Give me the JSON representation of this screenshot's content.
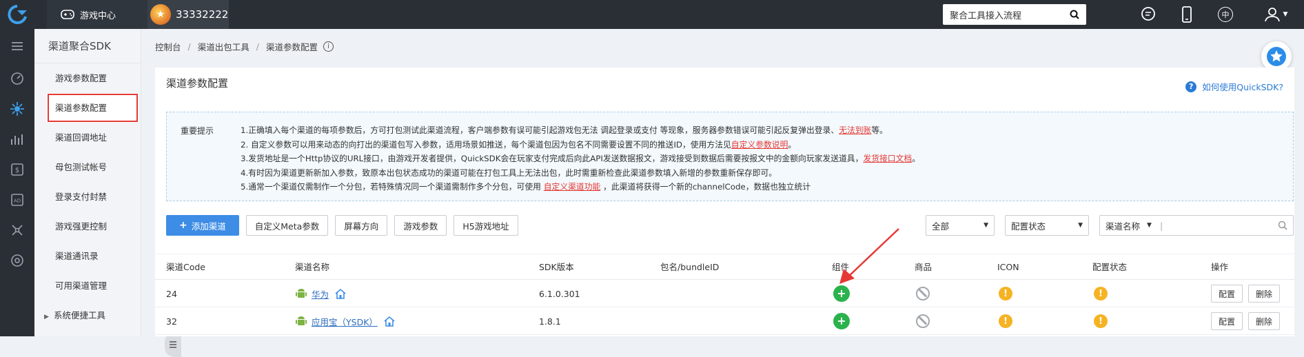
{
  "topbar": {
    "game_center_label": "游戏中心",
    "account_number": "33332222",
    "search_value": "聚合工具接入流程",
    "lang_label": "中"
  },
  "sidebar": {
    "title": "渠道聚合SDK",
    "items": [
      {
        "label": "游戏参数配置"
      },
      {
        "label": "渠道参数配置"
      },
      {
        "label": "渠道回调地址"
      },
      {
        "label": "母包测试帐号"
      },
      {
        "label": "登录支付封禁"
      },
      {
        "label": "游戏强更控制"
      },
      {
        "label": "渠道通讯录"
      },
      {
        "label": "可用渠道管理"
      },
      {
        "label": "系统便捷工具"
      }
    ]
  },
  "breadcrumb": [
    "控制台",
    "渠道出包工具",
    "渠道参数配置"
  ],
  "panel": {
    "title": "渠道参数配置",
    "help_link": "如何使用QuickSDK?"
  },
  "notice": {
    "label": "重要提示",
    "line1_pre": "1.正确填入每个渠道的每项参数后，方可打包测试此渠道流程，客户端参数有误可能引起游戏包无法 调起登录或支付 等现象，服务器参数错误可能引起反复弹出登录、",
    "line1_link": "无法到账",
    "line1_post": "等。",
    "line2_pre": "2. 自定义参数可以用来动态的向打出的渠道包写入参数，适用场景如推送，每个渠道包因为包名不同需要设置不同的推送ID，使用方法见",
    "line2_link": "自定义参数说明",
    "line2_post": "。",
    "line3_pre": "3.发货地址是一个Http协议的URL接口，由游戏开发者提供，QuickSDK会在玩家支付完成后向此API发送数据报文，游戏接受到数据后需要按报文中的金额向玩家发送道具，",
    "line3_link": "发货接口文档",
    "line3_post": "。",
    "line4": "4.有时因为渠道更新新加入参数，致原本出包状态成功的渠道可能在打包工具上无法出包，此时需重新检查此渠道参数填入新增的参数重新保存即可。",
    "line5_pre": "5.通常一个渠道仅需制作一个分包，若特殊情况同一个渠道需制作多个分包，可使用 ",
    "line5_link": "自定义渠道功能",
    "line5_post": " ，此渠道将获得一个新的channelCode，数据也独立统计"
  },
  "toolbar": {
    "add_label": "添加渠道",
    "meta_label": "自定义Meta参数",
    "orientation_label": "屏幕方向",
    "game_params_label": "游戏参数",
    "h5_label": "H5游戏地址",
    "filter_all": "全部",
    "filter_status": "配置状态",
    "search_field": "渠道名称"
  },
  "table": {
    "headers": [
      "渠道Code",
      "渠道名称",
      "SDK版本",
      "包名/bundleID",
      "组件",
      "商品",
      "ICON",
      "配置状态",
      "操作"
    ],
    "rows": [
      {
        "code": "24",
        "name": "华为",
        "sdk": "6.1.0.301",
        "bundle": "",
        "config_label": "配置",
        "delete_label": "删除"
      },
      {
        "code": "32",
        "name": "应用宝（YSDK）",
        "sdk": "1.8.1",
        "bundle": "",
        "config_label": "配置",
        "delete_label": "删除"
      }
    ]
  },
  "colors": {
    "accent": "#3d8ce6",
    "topbar": "#2a2f36",
    "success": "#2bb24c",
    "warning": "#f5b324",
    "danger": "#e53935"
  }
}
